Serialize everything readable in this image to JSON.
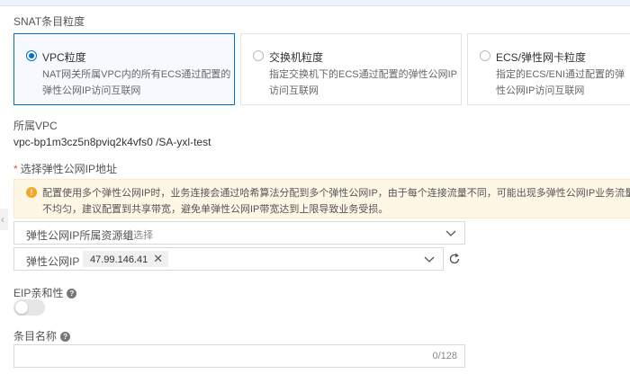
{
  "snat": {
    "section_label": "SNAT条目粒度",
    "options": [
      {
        "title": "VPC粒度",
        "desc": "NAT网关所属VPC内的所有ECS通过配置的弹性公网IP访问互联网",
        "selected": true
      },
      {
        "title": "交换机粒度",
        "desc": "指定交换机下的ECS通过配置的弹性公网IP访问互联网",
        "selected": false
      },
      {
        "title": "ECS/弹性网卡粒度",
        "desc": "指定的ECS/ENI通过配置的弹性公网IP访问互联网",
        "selected": false
      }
    ]
  },
  "vpc": {
    "label": "所属VPC",
    "value": "vpc-bp1m3cz5n8pviq2k4vfs0 /SA-yxl-test"
  },
  "eip": {
    "required_label": "选择弹性公网IP地址",
    "alert": "配置使用多个弹性公网IP时，业务连接会通过哈希算法分配到多个弹性公网IP，由于每个连接流量不同，可能出现多弹性公网IP业务流量不均匀，建议配置到共享带宽，避免单弹性公网IP带宽达到上限导致业务受损。",
    "resource_group_label": "弹性公网IP所属资源组",
    "resource_group_placeholder": "请选择",
    "ip_label": "弹性公网IP",
    "ip_selected": "47.99.146.41"
  },
  "affinity": {
    "label": "EIP亲和性",
    "enabled": false
  },
  "entry_name": {
    "label": "条目名称",
    "counter": "0/128",
    "value": ""
  },
  "colors": {
    "accent": "#0070cc",
    "warning": "#f5a623",
    "required": "#e0513c"
  },
  "icons": [
    "radio-icon",
    "warning-icon",
    "chevron-down-icon",
    "close-icon",
    "refresh-icon",
    "help-icon",
    "collapse-arrow-icon"
  ]
}
